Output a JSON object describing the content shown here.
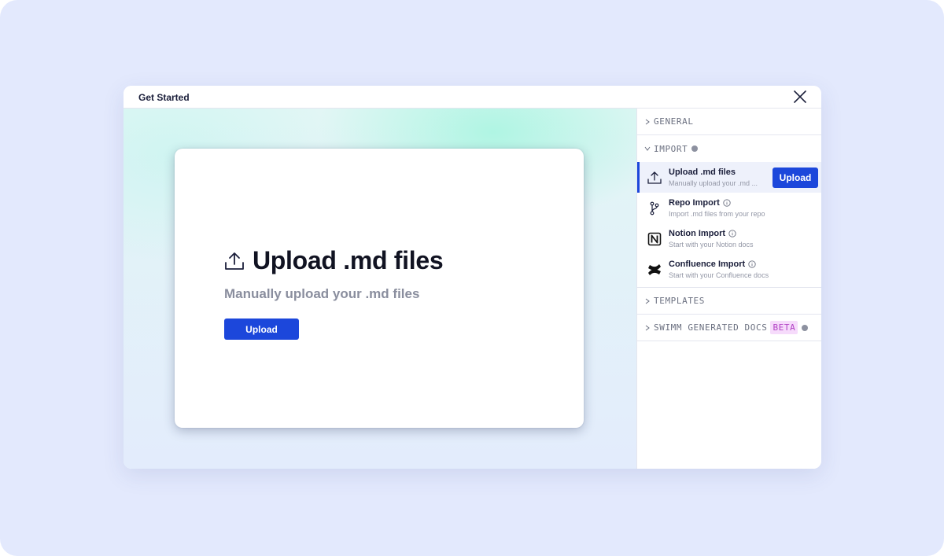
{
  "modal": {
    "title": "Get Started"
  },
  "preview": {
    "title": "Upload .md files",
    "subtitle": "Manually upload your .md files",
    "button_label": "Upload"
  },
  "sidebar": {
    "sections": {
      "general": {
        "label": "GENERAL"
      },
      "import": {
        "label": "IMPORT"
      },
      "templates": {
        "label": "TEMPLATES"
      },
      "swimm": {
        "label": "SWIMM GENERATED DOCS",
        "badge": "BETA"
      }
    },
    "import_items": [
      {
        "title": "Upload .md files",
        "desc": "Manually upload your .md ...",
        "button_label": "Upload",
        "icon": "upload-icon",
        "active": true
      },
      {
        "title": "Repo Import",
        "desc": "Import .md files from your repo",
        "icon": "git-branch-icon"
      },
      {
        "title": "Notion Import",
        "desc": "Start with your Notion docs",
        "icon": "notion-icon"
      },
      {
        "title": "Confluence Import",
        "desc": "Start with your Confluence docs",
        "icon": "confluence-icon"
      }
    ]
  },
  "colors": {
    "accent": "#1c47db",
    "backdrop": "#e3e9fd",
    "beta_bg": "#f6dbfb",
    "beta_text": "#b142c4"
  }
}
